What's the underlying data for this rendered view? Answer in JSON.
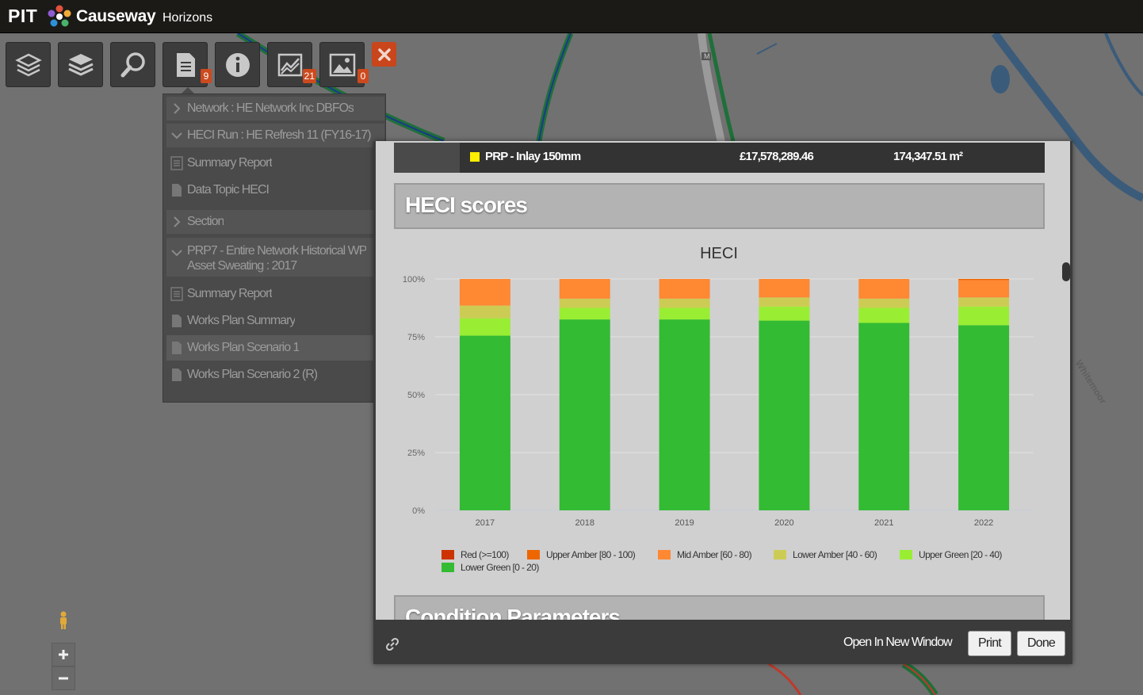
{
  "header": {
    "brand_short": "PIT",
    "brand_name": "Causeway",
    "brand_sub": "Horizons"
  },
  "toolbar": {
    "tools": [
      {
        "name": "layers-outline-tool",
        "icon": "layers-outline-icon",
        "badge": ""
      },
      {
        "name": "layers-tool",
        "icon": "layers-icon",
        "badge": ""
      },
      {
        "name": "search-tool",
        "icon": "search-icon",
        "badge": ""
      },
      {
        "name": "reports-tool",
        "icon": "document-icon",
        "badge": "9"
      },
      {
        "name": "info-tool",
        "icon": "info-icon",
        "badge": ""
      },
      {
        "name": "charts-tool",
        "icon": "chart-icon",
        "badge": "21"
      },
      {
        "name": "images-tool",
        "icon": "image-icon",
        "badge": "0"
      }
    ]
  },
  "sidepanel": {
    "network": "Network : HE Network Inc DBFOs",
    "heci_run": "HECI Run : HE Refresh 11 (FY16-17)",
    "summary_report_1": "Summary Report",
    "data_topic": "Data Topic HECI",
    "section": "Section",
    "prp7_line1": "PRP7 - Entire Network Historical WP",
    "prp7_line2": "Asset Sweating : 2017",
    "summary_report_2": "Summary Report",
    "works_plan_summary": "Works Plan Summary",
    "scenario_1": "Works Plan Scenario 1",
    "scenario_2": "Works Plan Scenario 2 (R)"
  },
  "modal": {
    "inlay_name": "PRP - Inlay 150mm",
    "inlay_cost": "£17,578,289.46",
    "inlay_area": "174,347.51 m²",
    "heci_heading": "HECI scores",
    "condition_heading": "Condition Parameters",
    "open_new_window": "Open In New Window",
    "print": "Print",
    "done": "Done"
  },
  "colors": {
    "red": "#cc3300",
    "upper_amber": "#ee6600",
    "mid_amber": "#ff8833",
    "lower_amber": "#cccc55",
    "upper_green": "#99ee33",
    "lower_green": "#33bb33",
    "inlay_swatch": "#ffee00"
  },
  "chart_data": {
    "type": "bar",
    "stacked": true,
    "title": "HECI",
    "categories": [
      "2017",
      "2018",
      "2019",
      "2020",
      "2021",
      "2022"
    ],
    "y_ticks": [
      "0%",
      "25%",
      "50%",
      "75%",
      "100%"
    ],
    "ylim": [
      0,
      100
    ],
    "grid": true,
    "legend_position": "bottom",
    "series": [
      {
        "name": "Lower Green [0 - 20)",
        "color": "#33bb33",
        "values": [
          75.5,
          82.5,
          82.5,
          82.0,
          81.0,
          80.0
        ]
      },
      {
        "name": "Upper Green [20 - 40)",
        "color": "#99ee33",
        "values": [
          7.5,
          5.0,
          5.0,
          6.0,
          6.5,
          8.0
        ]
      },
      {
        "name": "Lower Amber [40 - 60)",
        "color": "#cccc55",
        "values": [
          5.5,
          4.0,
          4.0,
          4.0,
          4.0,
          4.0
        ]
      },
      {
        "name": "Mid Amber [60 - 80)",
        "color": "#ff8833",
        "values": [
          11.5,
          8.5,
          8.5,
          8.0,
          8.5,
          7.5
        ]
      },
      {
        "name": "Upper Amber [80 - 100)",
        "color": "#ee6600",
        "values": [
          0,
          0,
          0,
          0,
          0,
          0.5
        ]
      },
      {
        "name": "Red (>=100)",
        "color": "#cc3300",
        "values": [
          0,
          0,
          0,
          0,
          0,
          0
        ]
      }
    ],
    "legend_order": [
      "Red (>=100)",
      "Upper Amber [80 - 100)",
      "Mid Amber [60 - 80)",
      "Lower Amber [40 - 60)",
      "Upper Green [20 - 40)",
      "Lower Green [0 - 20)"
    ]
  },
  "map": {
    "road_label": "M",
    "place_label": "Whitemoor"
  }
}
